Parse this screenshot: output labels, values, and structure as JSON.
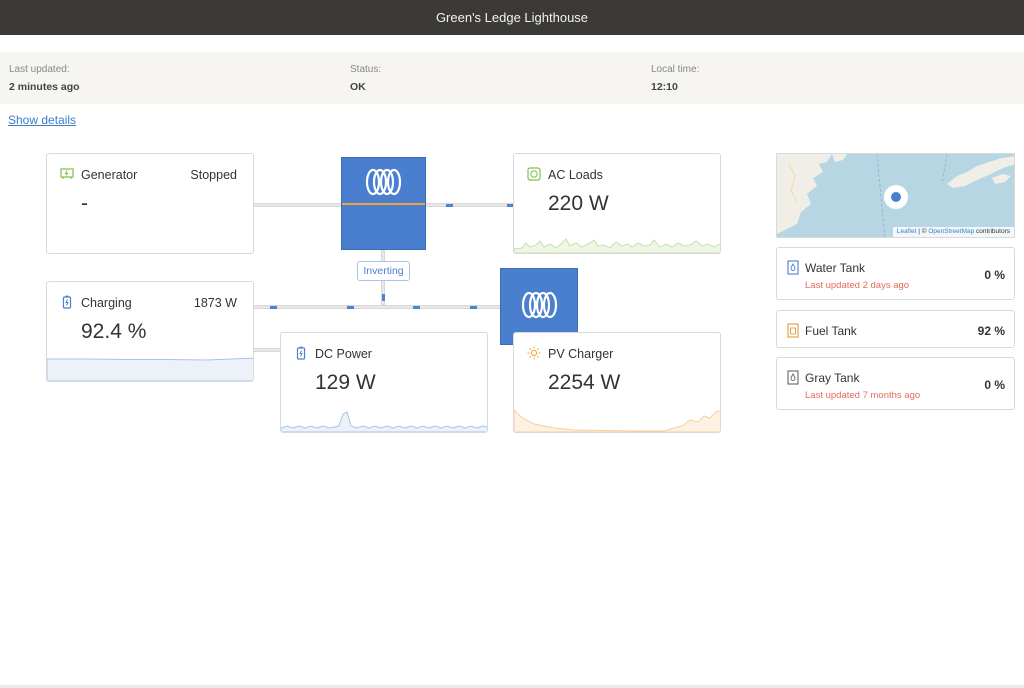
{
  "header": {
    "title": "Green's Ledge Lighthouse"
  },
  "status_bar": {
    "last_updated_label": "Last updated:",
    "last_updated_value": "2 minutes ago",
    "status_label": "Status:",
    "status_value": "OK",
    "local_time_label": "Local time:",
    "local_time_value": "12:10"
  },
  "show_details": "Show details",
  "generator": {
    "title": "Generator",
    "state": "Stopped",
    "value": "-"
  },
  "ac_loads": {
    "title": "AC Loads",
    "value": "220 W"
  },
  "battery": {
    "title": "Charging",
    "power": "1873 W",
    "value": "92.4 %"
  },
  "dc_power": {
    "title": "DC Power",
    "value": "129 W"
  },
  "pv_charger": {
    "title": "PV Charger",
    "value": "2254 W"
  },
  "inverter_badge": "Inverting",
  "map": {
    "attr_leaflet": "Leaflet",
    "attr_sep": " | © ",
    "attr_osm": "OpenStreetMap",
    "attr_rest": " contributors"
  },
  "tanks": [
    {
      "name": "Water Tank",
      "percent": "0 %",
      "subtitle": "Last updated 2 days ago",
      "color": "#4a7fcf"
    },
    {
      "name": "Fuel Tank",
      "percent": "92 %",
      "subtitle": "",
      "color": "#e59a3c"
    },
    {
      "name": "Gray Tank",
      "percent": "0 %",
      "subtitle": "Last updated 7 months ago",
      "color": "#666666"
    }
  ],
  "colors": {
    "accent_blue": "#4a7fcf",
    "generator_green": "#7cc24b",
    "pv_orange": "#f0a640",
    "alert_red": "#e46a5e",
    "header_bg": "#3c3a37"
  }
}
